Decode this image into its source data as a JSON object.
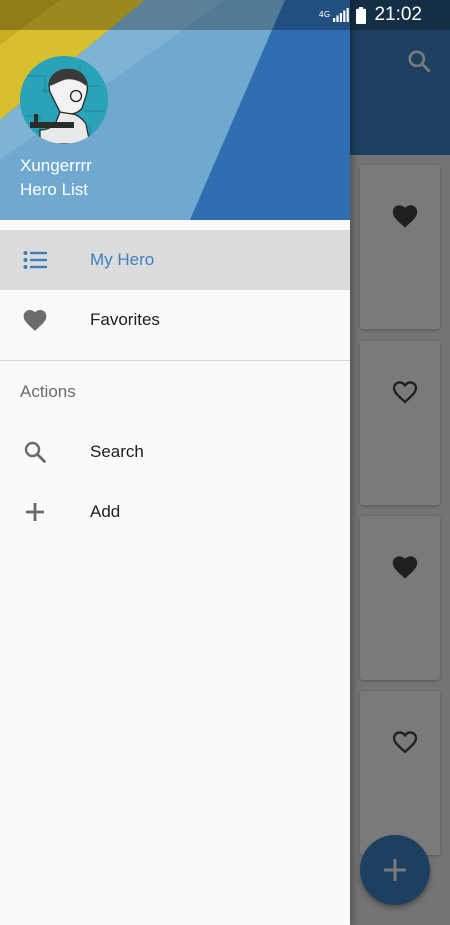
{
  "status_bar": {
    "network": "4G",
    "time": "21:02",
    "icons": [
      "network-4g-icon",
      "signal-icon",
      "battery-icon"
    ]
  },
  "drawer": {
    "user_name": "Xungerrrr",
    "subtitle": "Hero List",
    "avatar": "avatar-icon",
    "items": [
      {
        "label": "My Hero",
        "icon": "list-icon",
        "active": true
      },
      {
        "label": "Favorites",
        "icon": "heart-icon",
        "active": false
      }
    ],
    "section_title": "Actions",
    "actions": [
      {
        "label": "Search",
        "icon": "search-icon"
      },
      {
        "label": "Add",
        "icon": "plus-icon"
      }
    ]
  },
  "background_list": {
    "favorites": [
      true,
      false,
      true,
      false
    ]
  },
  "colors": {
    "primary": "#3d86c9",
    "active_text": "#3c7fc1",
    "header_yellow": "#d8bf2e",
    "icon_gray": "#6b6b6b"
  }
}
